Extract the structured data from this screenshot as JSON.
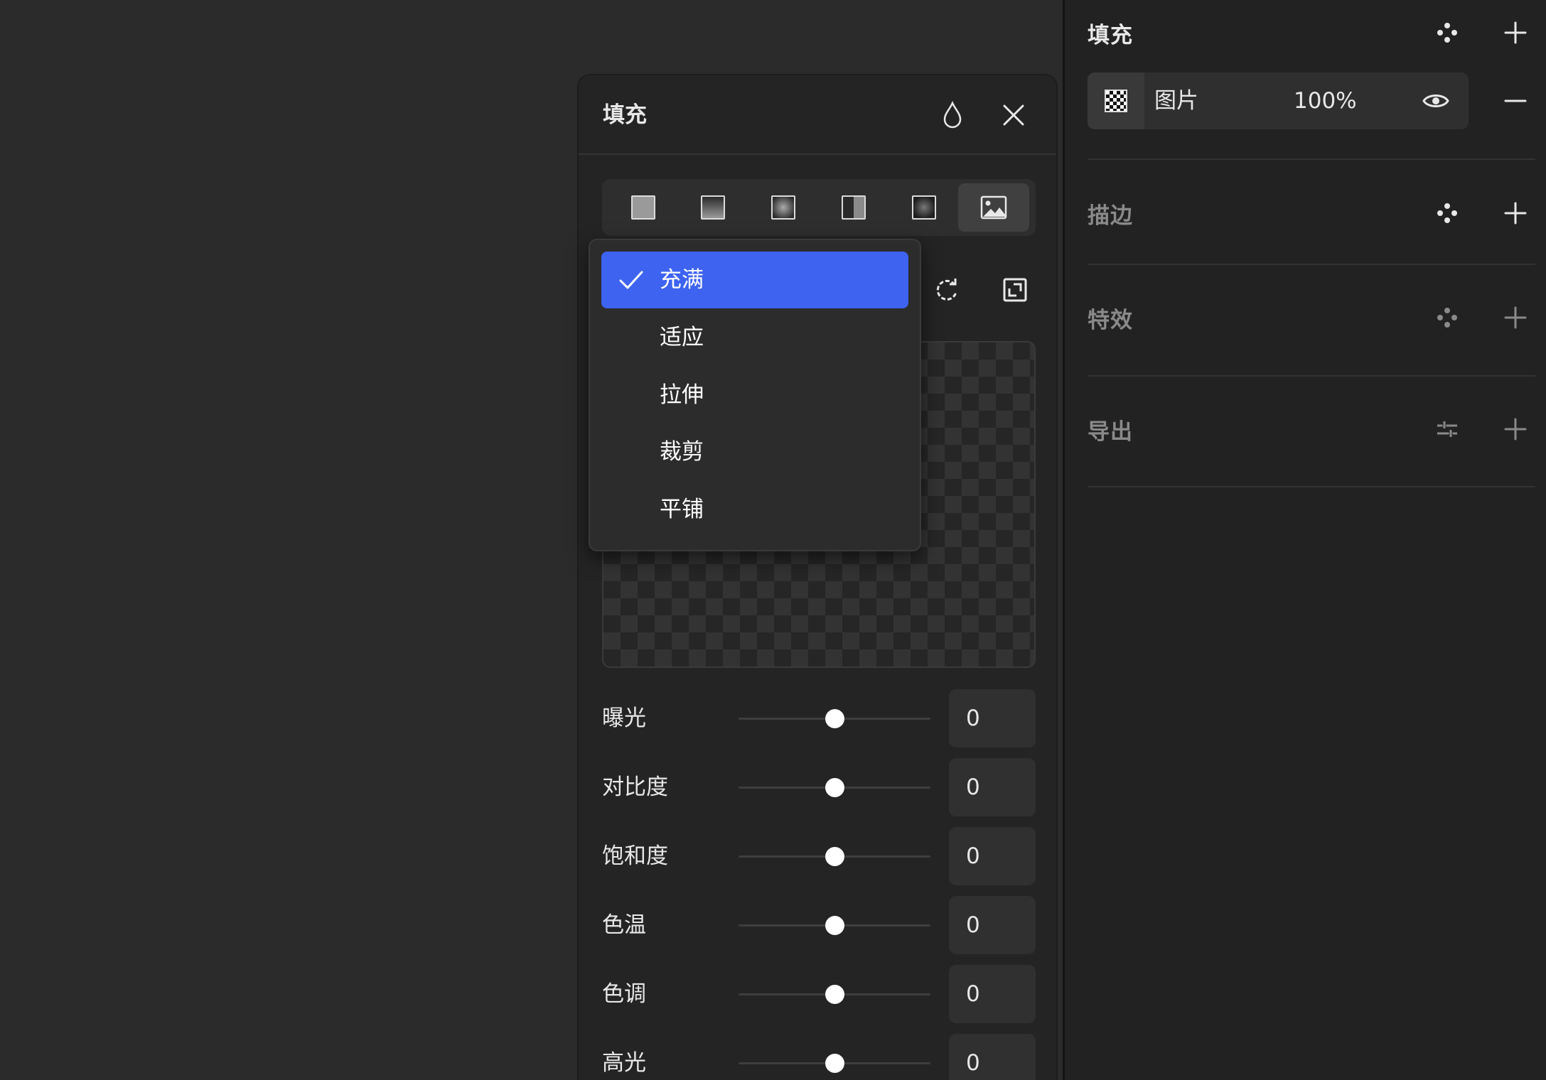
{
  "sidebar": {
    "fill": {
      "title": "填充",
      "icon_style": "style-dots-icon",
      "icon_add": "plus-icon"
    },
    "fill_layer": {
      "type_label": "图片",
      "opacity": "100%",
      "icon_visibility": "eye-icon",
      "icon_remove": "minus-icon"
    },
    "stroke": {
      "title": "描边"
    },
    "effects": {
      "title": "特效"
    },
    "export": {
      "title": "导出",
      "icon_settings": "sliders-icon"
    }
  },
  "fill_popover": {
    "title": "填充",
    "icon_eyedropper": "drop-icon",
    "icon_close": "close-icon",
    "fill_types": [
      {
        "name": "solid",
        "icon": "solid-fill-icon",
        "active": false
      },
      {
        "name": "linear-gradient",
        "icon": "linear-gradient-icon",
        "active": false
      },
      {
        "name": "radial-gradient",
        "icon": "radial-gradient-icon",
        "active": false
      },
      {
        "name": "angular-gradient",
        "icon": "angular-gradient-icon",
        "active": false
      },
      {
        "name": "diamond-gradient",
        "icon": "diamond-gradient-icon",
        "active": false
      },
      {
        "name": "image",
        "icon": "image-icon",
        "active": true
      }
    ],
    "icon_rotate": "rotate-icon",
    "icon_expand": "expand-icon",
    "adjustments": [
      {
        "label": "曝光",
        "value": "0",
        "level": 0.5
      },
      {
        "label": "对比度",
        "value": "0",
        "level": 0.5
      },
      {
        "label": "饱和度",
        "value": "0",
        "level": 0.5
      },
      {
        "label": "色温",
        "value": "0",
        "level": 0.5
      },
      {
        "label": "色调",
        "value": "0",
        "level": 0.5
      },
      {
        "label": "高光",
        "value": "0",
        "level": 0.5
      }
    ]
  },
  "scale_dropdown": {
    "selected": "充满",
    "items": [
      "充满",
      "适应",
      "拉伸",
      "裁剪",
      "平铺"
    ]
  },
  "colors": {
    "accent": "#3d63f0",
    "sidebar_bg": "#222222",
    "canvas_bg": "#2b2b2b",
    "text": "#e8e8e8",
    "text_dim": "#8a8a8a"
  }
}
